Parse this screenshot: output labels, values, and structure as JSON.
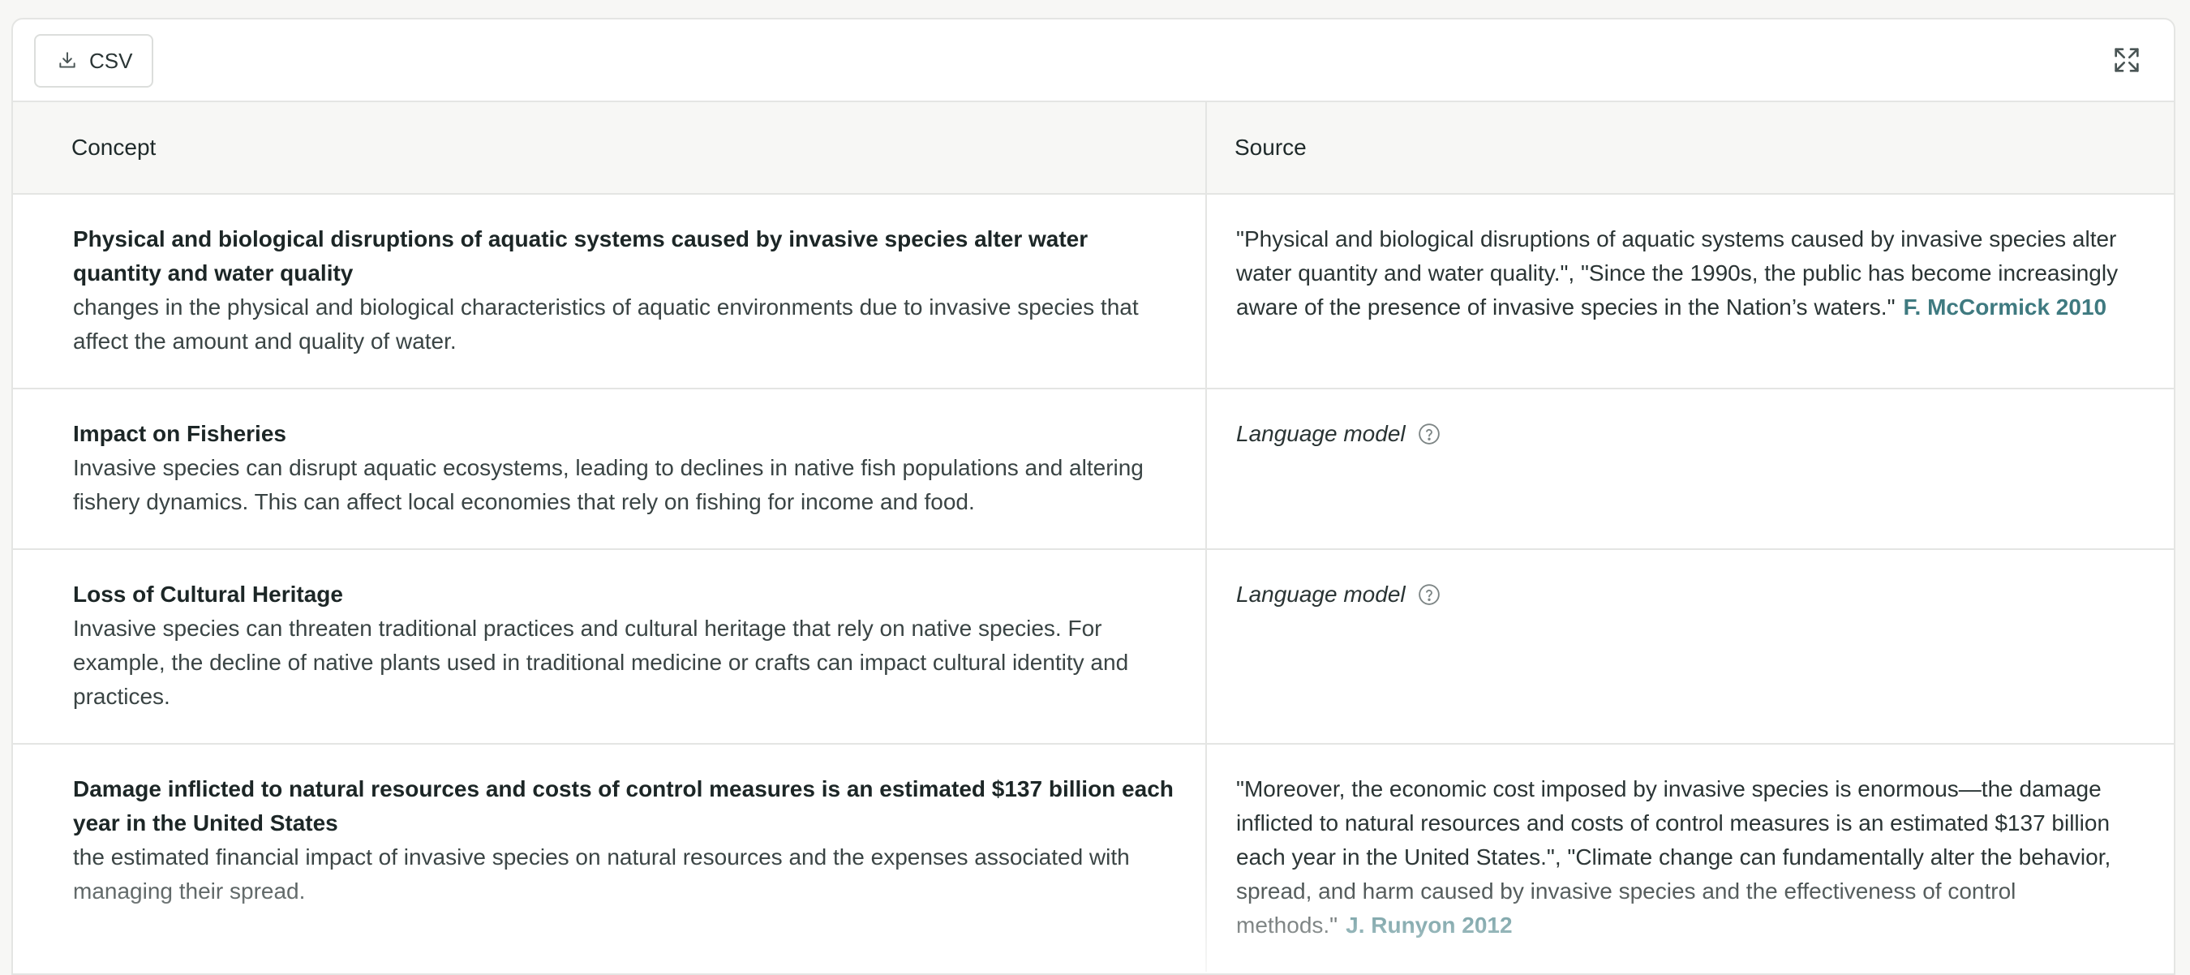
{
  "toolbar": {
    "csv_label": "CSV"
  },
  "table": {
    "headers": [
      "Concept",
      "Source"
    ],
    "rows": [
      {
        "title": "Physical and biological disruptions of aquatic systems caused by invasive species alter water quantity and water quality",
        "description": "changes in the physical and biological characteristics of aquatic environments due to invasive species that affect the amount and quality of water.",
        "source_text": "\"Physical and biological disruptions of aquatic systems caused by invasive species alter water quantity and water quality.\", \"Since the 1990s, the public has become increasingly aware of the presence of invasive species in the Nation’s waters.\"",
        "citation": "F. McCormick 2010"
      },
      {
        "title": "Impact on Fisheries",
        "description": "Invasive species can disrupt aquatic ecosystems, leading to declines in native fish populations and altering fishery dynamics. This can affect local economies that rely on fishing for income and food.",
        "source_model": "Language model"
      },
      {
        "title": "Loss of Cultural Heritage",
        "description": "Invasive species can threaten traditional practices and cultural heritage that rely on native species. For example, the decline of native plants used in traditional medicine or crafts can impact cultural identity and practices.",
        "source_model": "Language model"
      },
      {
        "title": "Damage inflicted to natural resources and costs of control measures is an estimated $137 billion each year in the United States",
        "description": "the estimated financial impact of invasive species on natural resources and the expenses associated with managing their spread.",
        "source_text": "\"Moreover, the economic cost imposed by invasive species is enormous—the damage inflicted to natural resources and costs of control measures is an estimated $137 billion each year in the United States.\", \"Climate change can fundamentally alter the behavior, spread, and harm caused by invasive species and the effectiveness of control methods.\"",
        "citation": "J. Runyon 2012"
      }
    ]
  },
  "icons": {
    "download": "download-icon",
    "expand": "expand-icon",
    "help": "help-circle-icon"
  },
  "colors": {
    "citation": "#3f7a80",
    "border": "#e4e5e3",
    "header_bg": "#f7f7f5"
  }
}
